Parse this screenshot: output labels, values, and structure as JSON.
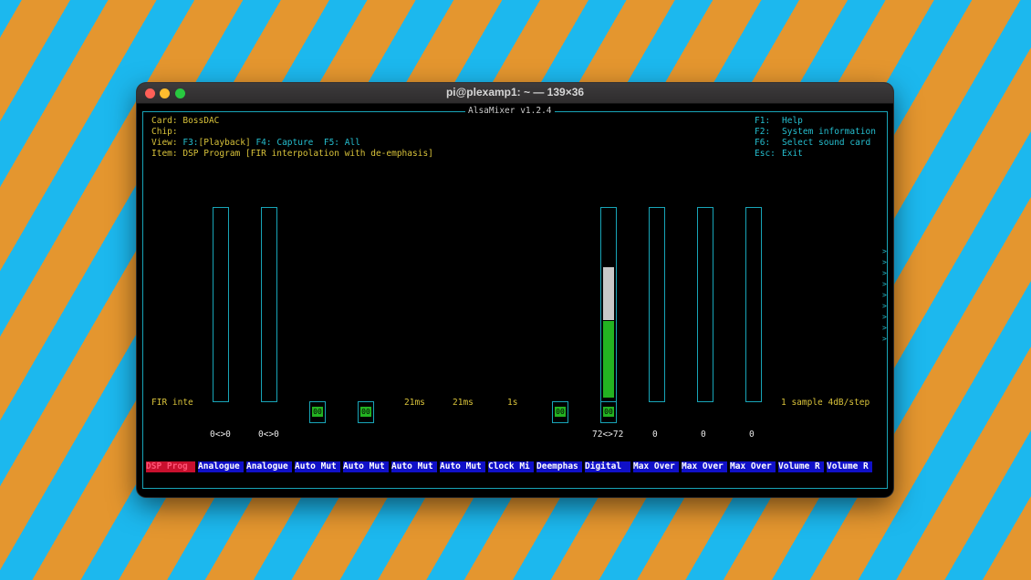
{
  "window": {
    "title": "pi@plexamp1: ~ — 139×36",
    "buttons": [
      "close",
      "minimize",
      "zoom"
    ]
  },
  "mixer": {
    "frame_title": "AlsaMixer v1.2.4",
    "card_label": "Card:",
    "card_value": "BossDAC",
    "chip_label": "Chip:",
    "view_label": "View:",
    "view_f3": "F3:",
    "view_playback": "[Playback]",
    "view_f4": "F4:",
    "view_capture": "Capture",
    "view_f5": "F5:",
    "view_all": "All",
    "item_label": "Item:",
    "item_value": "DSP Program [FIR interpolation with de-emphasis]"
  },
  "help": [
    {
      "key": "F1:",
      "text": "Help"
    },
    {
      "key": "F2:",
      "text": "System information"
    },
    {
      "key": "F6:",
      "text": "Select sound card"
    },
    {
      "key": "Esc:",
      "text": "Exit"
    }
  ],
  "side_values": {
    "left": "FIR inte",
    "right": "1 sample 4dB/step"
  },
  "controls": [
    {
      "name": "DSP Prog",
      "selected": true
    },
    {
      "name": "Analogue",
      "value": "0<>0",
      "type": "slider",
      "level": 0
    },
    {
      "name": "Analogue",
      "value": "0<>0",
      "type": "slider",
      "level": 0
    },
    {
      "name": "Auto Mut",
      "type": "switch",
      "state": "00"
    },
    {
      "name": "Auto Mut",
      "type": "switch",
      "state": "00"
    },
    {
      "name": "Auto Mut",
      "status": "21ms"
    },
    {
      "name": "Auto Mut",
      "status": "21ms"
    },
    {
      "name": "Clock Mi",
      "status": "1s"
    },
    {
      "name": "Deemphas",
      "type": "switch",
      "state": "00"
    },
    {
      "name": "Digital",
      "value": "72<>72",
      "type": "slider",
      "level": 0.72,
      "state": "00"
    },
    {
      "name": "Max Over",
      "value": "0",
      "type": "slider",
      "level": 0
    },
    {
      "name": "Max Over",
      "value": "0",
      "type": "slider",
      "level": 0
    },
    {
      "name": "Max Over",
      "value": "0",
      "type": "slider",
      "level": 0
    },
    {
      "name": "Volume R"
    },
    {
      "name": "Volume R"
    }
  ],
  "colors": {
    "header_text": "#d8c23a",
    "key_text": "#25bfd0",
    "border": "#18a5b8",
    "label_bg": "#1010c8",
    "selected_bg": "#c8102e",
    "level_green": "#23b321",
    "level_white": "#c8c8c8"
  }
}
